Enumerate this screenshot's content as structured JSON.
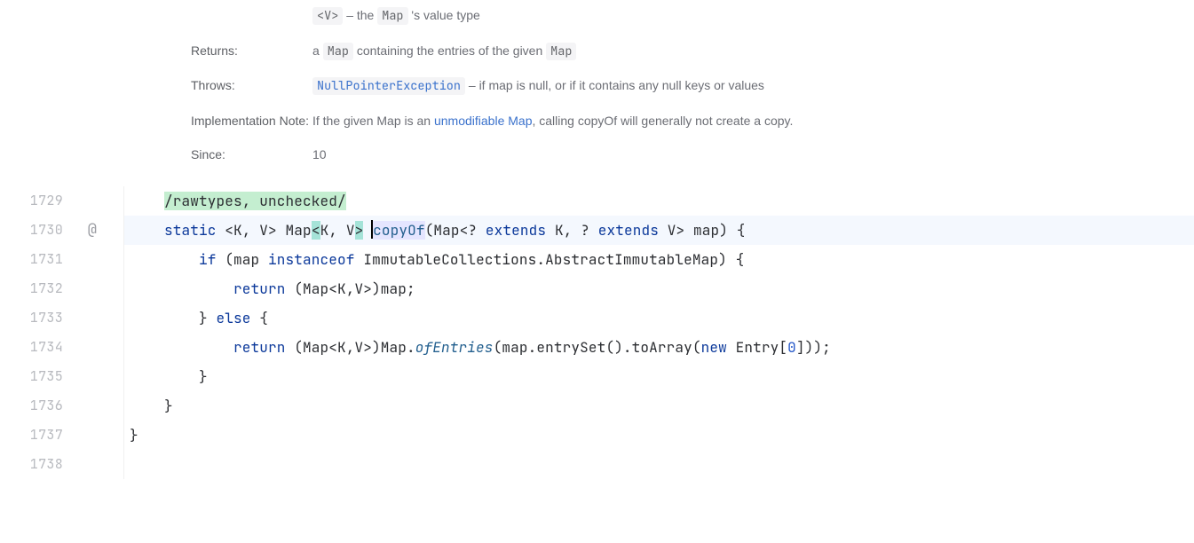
{
  "doc": {
    "typeparam_value": "<V>",
    "typeparam_desc_pre": " – the ",
    "typeparam_desc_code": "Map",
    "typeparam_desc_post": " 's value type",
    "returns_label": "Returns:",
    "returns_pre": "a ",
    "returns_code1": "Map",
    "returns_mid": " containing the entries of the given ",
    "returns_code2": "Map",
    "throws_label": "Throws:",
    "throws_code": "NullPointerException",
    "throws_desc": " – if map is null, or if it contains any null keys or values",
    "impl_label": "Implementation Note:",
    "impl_pre": "If the given Map is an ",
    "impl_link": "unmodifiable Map",
    "impl_post": ", calling copyOf will generally not create a copy.",
    "since_label": "Since:",
    "since_value": "10"
  },
  "lines": {
    "l1729": "1729",
    "l1730": "1730",
    "l1731": "1731",
    "l1732": "1732",
    "l1733": "1733",
    "l1734": "1734",
    "l1735": "1735",
    "l1736": "1736",
    "l1737": "1737",
    "l1738": "1738"
  },
  "ann_icon": "@",
  "code": {
    "l1729_text": "/rawtypes, unchecked/",
    "l1730_kw_static": "static",
    "l1730_sp1": " ",
    "l1730_generic_pre": "<K, V> Map",
    "l1730_hl_a": "<",
    "l1730_hl_mid": "K, V",
    "l1730_hl_b": ">",
    "l1730_sp2": " ",
    "l1730_method": "copyOf",
    "l1730_paren_o": "(",
    "l1730_ptype": "Map<? ",
    "l1730_kw_ext1": "extends",
    "l1730_ptype2": " K, ? ",
    "l1730_kw_ext2": "extends",
    "l1730_ptype3": " V> map) {",
    "l1731_kw_if": "if",
    "l1731_cond_pre": " (map ",
    "l1731_kw_instanceof": "instanceof",
    "l1731_cond_post": " ImmutableCollections.AbstractImmutableMap) {",
    "l1732_kw_return": "return",
    "l1732_rest": " (Map<K,V>)map;",
    "l1733_txt": "} ",
    "l1733_kw_else": "else",
    "l1733_brace": " {",
    "l1734_kw_return": "return",
    "l1734_cast": " (Map<K,V>)Map.",
    "l1734_static_call": "ofEntries",
    "l1734_mid": "(map.entrySet().toArray(",
    "l1734_kw_new": "new",
    "l1734_post": " Entry[",
    "l1734_num": "0",
    "l1734_end": "]));",
    "l1735_txt": "}",
    "l1736_txt": "}",
    "l1737_txt": "}",
    "l1738_txt": ""
  }
}
